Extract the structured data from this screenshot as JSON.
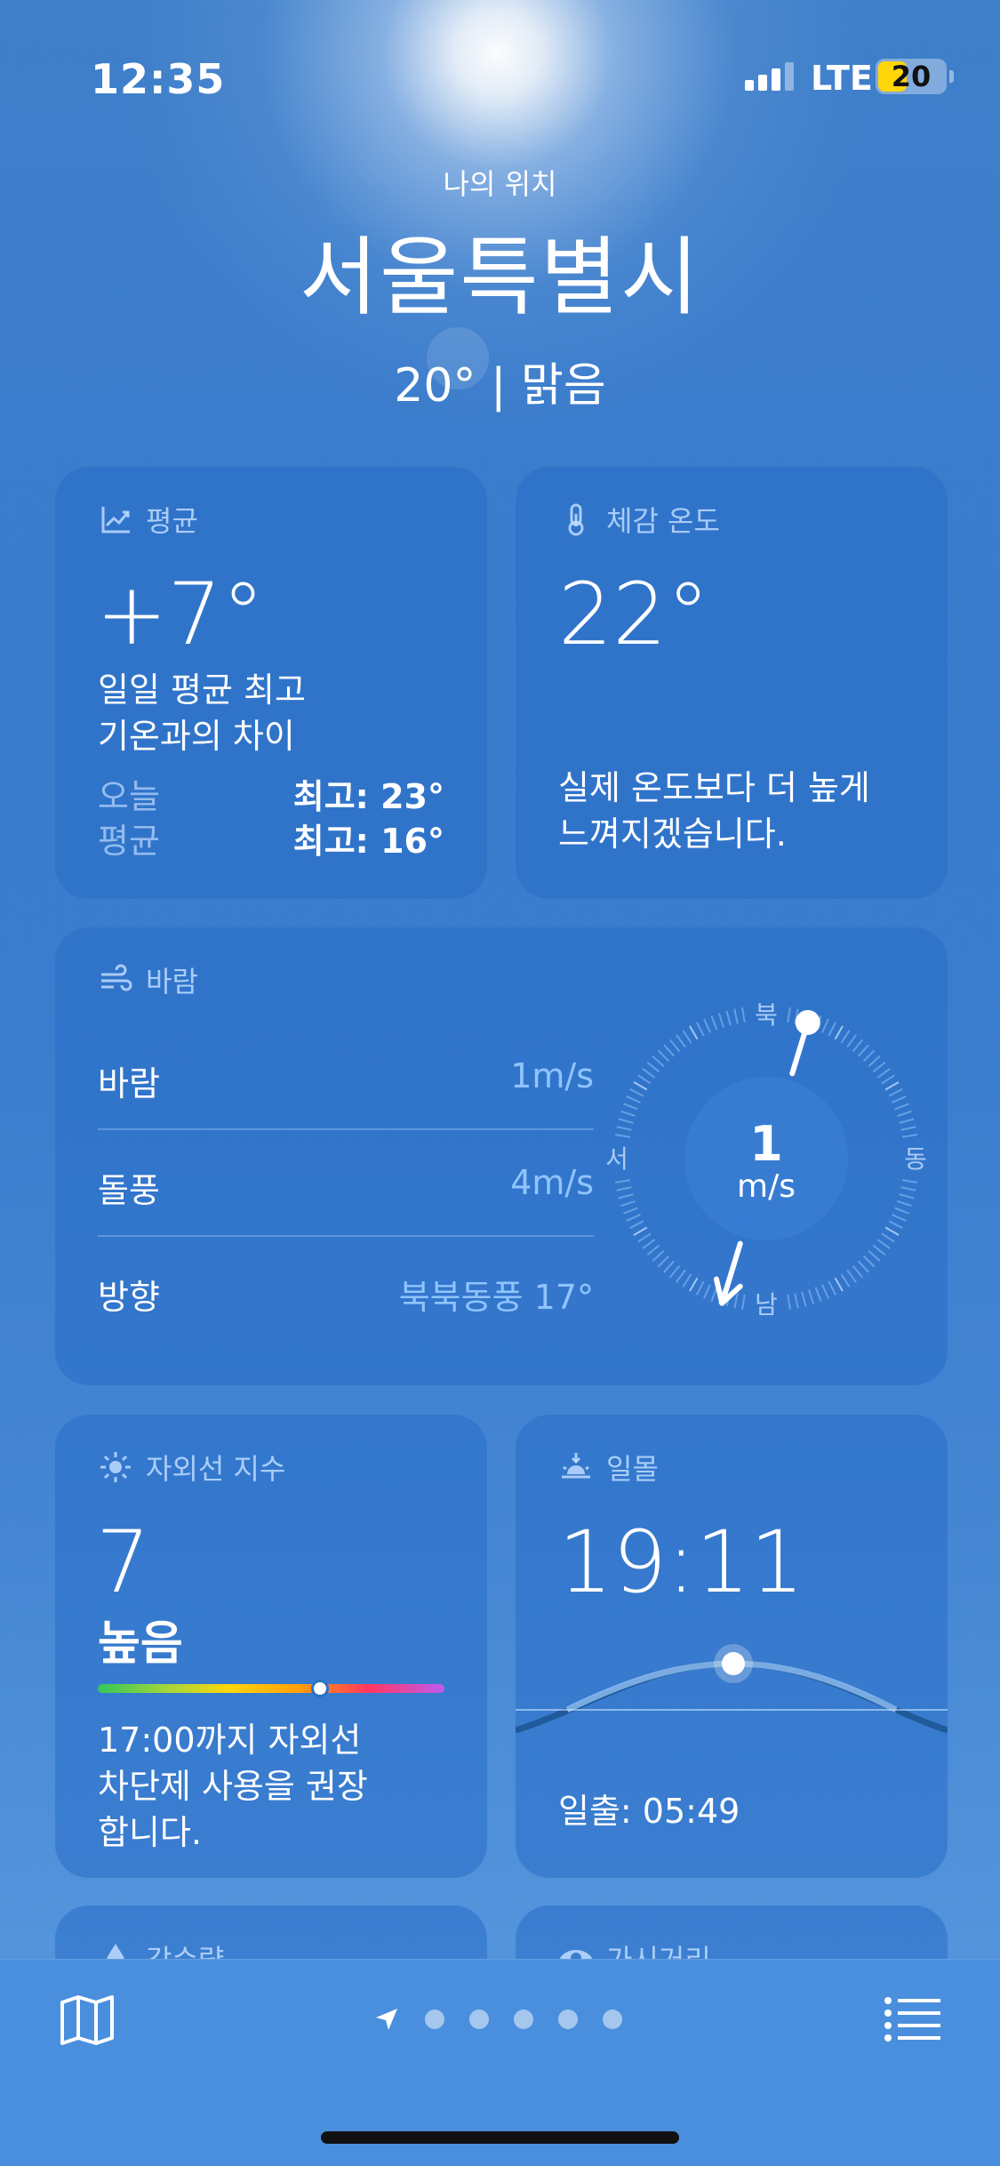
{
  "status_bar": {
    "time": "12:35",
    "network": "LTE",
    "battery": "20",
    "battery_color": "#ffd60a"
  },
  "header": {
    "location_label": "나의 위치",
    "city": "서울특별시",
    "current": "20° | 맑음"
  },
  "average_card": {
    "title": "평균",
    "icon": "chart-line-icon",
    "value": "+7°",
    "desc_line1": "일일 평균 최고",
    "desc_line2": "기온과의 차이",
    "today_label": "오늘",
    "today_value": "최고: 23°",
    "avg_label": "평균",
    "avg_value": "최고: 16°"
  },
  "feels_like_card": {
    "title": "체감 온도",
    "icon": "thermometer-icon",
    "value": "22°",
    "desc_line1": "실제 온도보다 더 높게",
    "desc_line2": "느껴지겠습니다."
  },
  "wind_card": {
    "title": "바람",
    "icon": "wind-icon",
    "rows": [
      {
        "label": "바람",
        "value": "1m/s"
      },
      {
        "label": "돌풍",
        "value": "4m/s"
      },
      {
        "label": "방향",
        "value": "북북동풍 17°"
      }
    ],
    "compass": {
      "north": "북",
      "south": "남",
      "east": "동",
      "west": "서",
      "speed": "1",
      "unit": "m/s",
      "direction_deg": 17
    }
  },
  "uv_card": {
    "title": "자외선 지수",
    "icon": "sun-icon",
    "value": "7",
    "level": "높음",
    "level_fraction": 0.64,
    "desc_line1": "17:00까지 자외선",
    "desc_line2": "차단제 사용을 권장",
    "desc_line3": "합니다."
  },
  "sunset_card": {
    "title": "일몰",
    "icon": "sunset-icon",
    "value": "19:11",
    "sunrise": "일출: 05:49"
  },
  "precip_card": {
    "title": "강수량",
    "icon": "raindrop-icon"
  },
  "visibility_card": {
    "title": "가시거리",
    "icon": "eye-icon"
  },
  "tab_bar": {
    "map_icon": "map-icon",
    "location_icon": "location-arrow-icon",
    "list_icon": "list-icon",
    "page_dots": 5
  }
}
